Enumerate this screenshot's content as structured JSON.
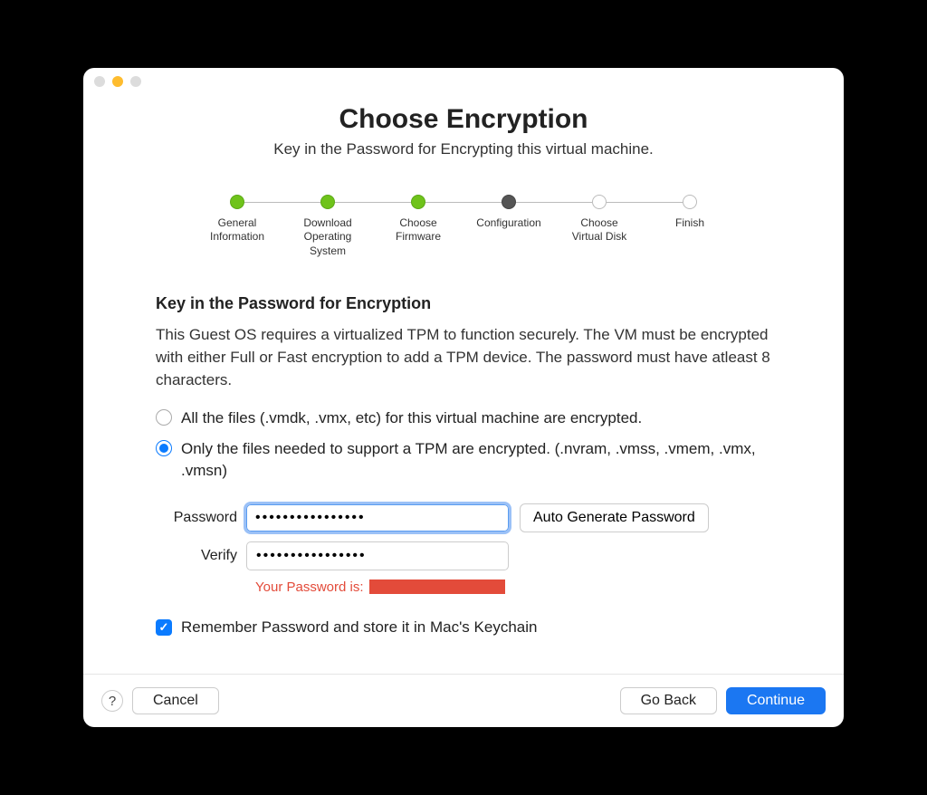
{
  "title": "Choose Encryption",
  "subtitle": "Key in the Password for Encrypting this virtual machine.",
  "stepper": {
    "steps": [
      {
        "label": "General\nInformation",
        "state": "done"
      },
      {
        "label": "Download\nOperating\nSystem",
        "state": "done"
      },
      {
        "label": "Choose\nFirmware",
        "state": "done"
      },
      {
        "label": "Configuration",
        "state": "current"
      },
      {
        "label": "Choose\nVirtual Disk",
        "state": "future"
      },
      {
        "label": "Finish",
        "state": "future"
      }
    ]
  },
  "section": {
    "heading": "Key in the Password for Encryption",
    "body": "This Guest OS requires a virtualized TPM to function securely. The VM must be encrypted with either Full or Fast encryption to add a TPM device. The password must have atleast 8 characters."
  },
  "options": {
    "full": "All the files (.vmdk, .vmx, etc) for this virtual machine are encrypted.",
    "fast": "Only the files needed to support a TPM are encrypted. (.nvram, .vmss, .vmem, .vmx, .vmsn)",
    "selected": "fast"
  },
  "form": {
    "password_label": "Password",
    "verify_label": "Verify",
    "password_value": "••••••••••••••••",
    "verify_value": "••••••••••••••••",
    "auto_generate": "Auto Generate Password",
    "hint_prefix": "Your Password is:"
  },
  "checkbox": {
    "label": "Remember Password and store it in Mac's Keychain",
    "checked": true
  },
  "footer": {
    "help": "?",
    "cancel": "Cancel",
    "back": "Go Back",
    "continue": "Continue"
  }
}
